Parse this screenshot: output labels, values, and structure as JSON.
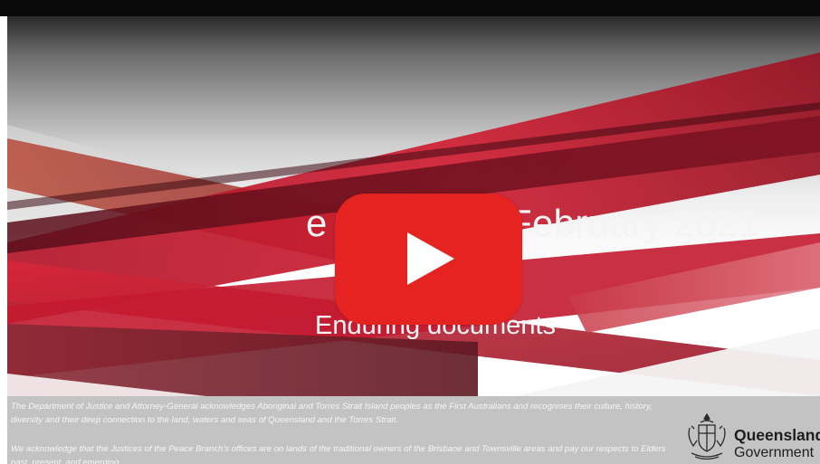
{
  "slide": {
    "headline_prefix": "e",
    "headline_suffix": "February 2021",
    "subtitle": "Enduring documents"
  },
  "player": {
    "play_button_label": "Play video",
    "brand_color": "#e52421"
  },
  "footer": {
    "acknowledgement_1": "The Department of Justice and Attorney-General acknowledges Aboriginal and Torres Strait Island peoples as the First Australians and recognises their culture, history, diversity and their deep connection to the land, waters and seas of Queensland and the Torres Strait.",
    "acknowledgement_2": "We acknowledge that the Justices of the Peace Branch's offices are on lands of the traditional owners of the Brisbane and Townsville areas and pay our respects to Elders past, present, and emerging."
  },
  "logo": {
    "line_1": "Queensland",
    "line_2": "Government",
    "icon": "coat-of-arms-icon"
  },
  "colors": {
    "accent_red": "#c8102e",
    "dark_red": "#7a1020",
    "footer_grey": "#c3c3c3"
  }
}
